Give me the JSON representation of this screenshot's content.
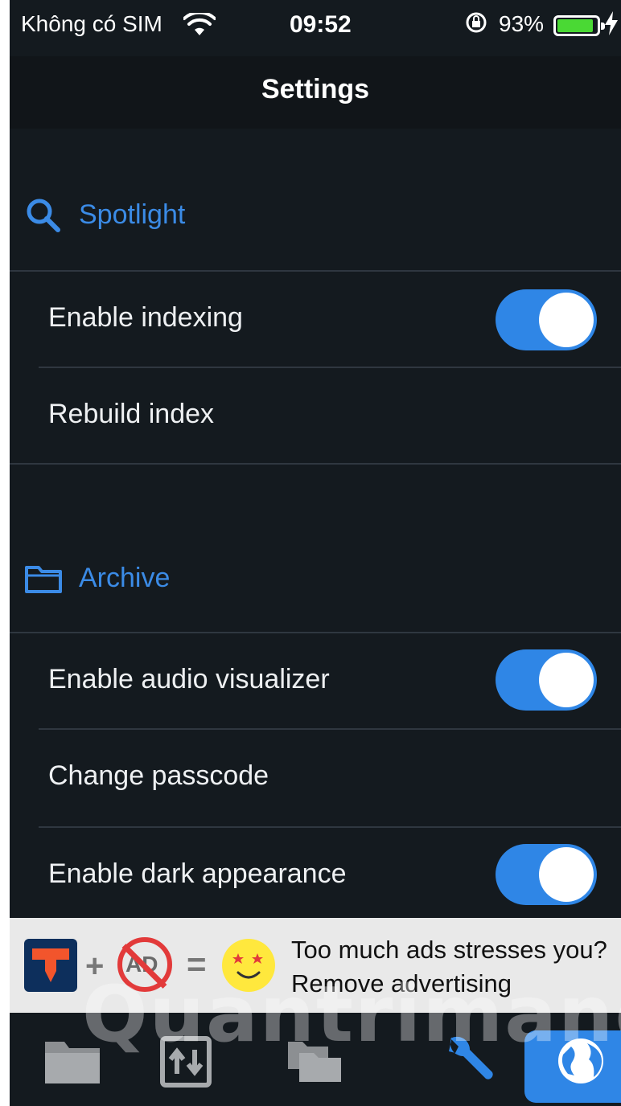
{
  "status_bar": {
    "carrier": "Không có SIM",
    "time": "09:52",
    "battery_percent": "93%",
    "battery_level": 0.93,
    "icons": [
      "wifi-icon",
      "rotation-lock-icon",
      "battery-icon",
      "charging-bolt-icon"
    ]
  },
  "nav": {
    "title": "Settings"
  },
  "sections": {
    "spotlight": {
      "title": "Spotlight",
      "icon": "search-icon",
      "rows": {
        "enable_indexing": {
          "label": "Enable indexing",
          "toggle_on": true
        },
        "rebuild_index": {
          "label": "Rebuild index"
        }
      }
    },
    "archive": {
      "title": "Archive",
      "icon": "folder-icon",
      "rows": {
        "enable_audio_visualizer": {
          "label": "Enable audio visualizer",
          "toggle_on": true
        },
        "change_passcode": {
          "label": "Change passcode"
        },
        "enable_dark_appearance": {
          "label": "Enable dark appearance",
          "toggle_on": true
        }
      }
    }
  },
  "ad": {
    "line1": "Too much ads stresses you?",
    "line2": "Remove advertising",
    "no_ad_text": "AD",
    "plus": "+",
    "equals": "="
  },
  "tab_bar": {
    "tabs": [
      "folder-icon",
      "transfer-icon",
      "files-icon",
      "wrench-icon",
      "globe-icon"
    ],
    "active": "globe-icon"
  },
  "watermark": "Quantrimang",
  "colors": {
    "accent": "#2f86e6",
    "background": "#141a1f",
    "battery": "#4ad934"
  }
}
